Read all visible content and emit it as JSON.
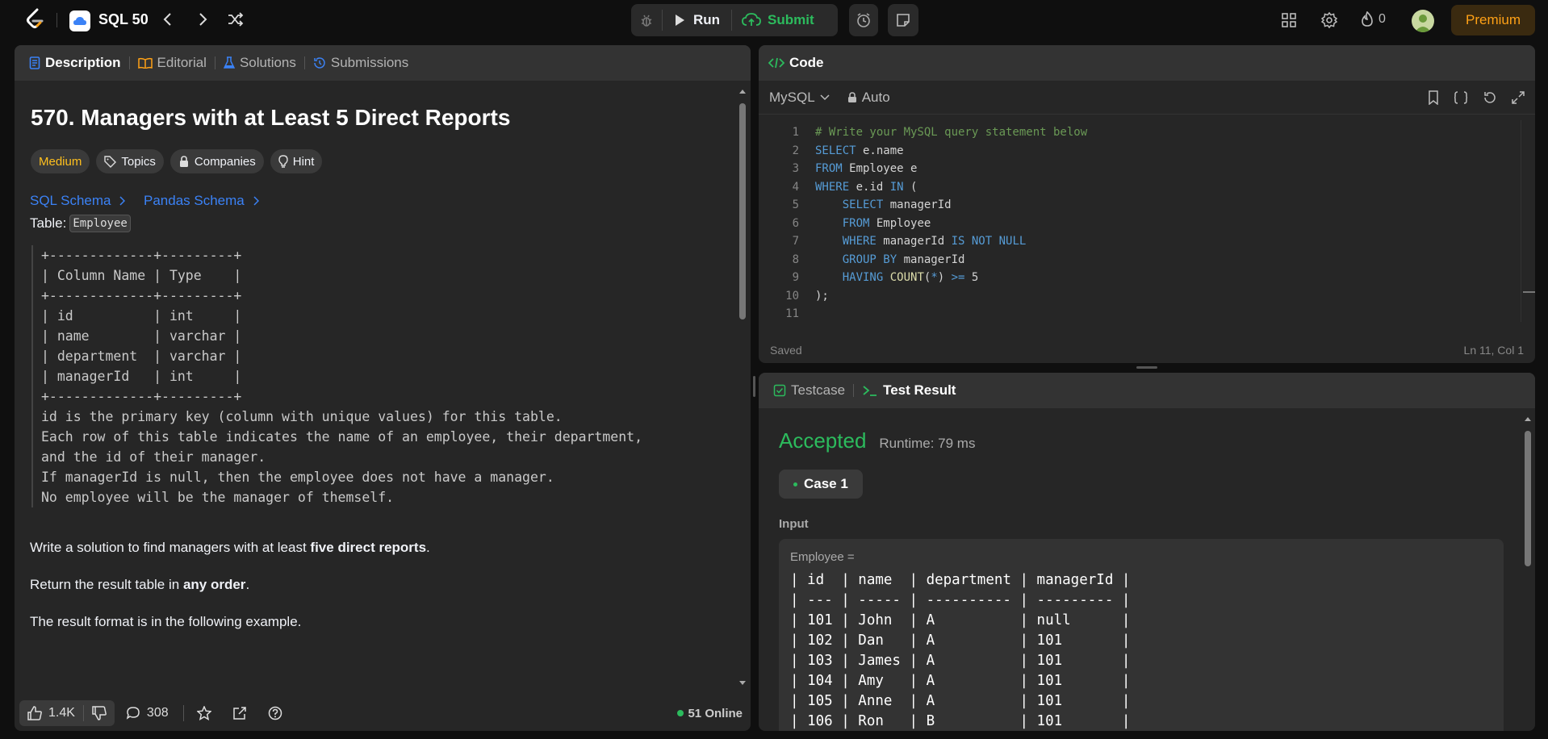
{
  "topbar": {
    "title": "SQL 50",
    "run_label": "Run",
    "submit_label": "Submit",
    "streak_count": "0",
    "premium_label": "Premium"
  },
  "description": {
    "tabs": [
      {
        "label": "Description",
        "icon": "document-icon"
      },
      {
        "label": "Editorial",
        "icon": "book-icon"
      },
      {
        "label": "Solutions",
        "icon": "flask-icon"
      },
      {
        "label": "Submissions",
        "icon": "history-icon"
      }
    ],
    "title": "570. Managers with at Least 5 Direct Reports",
    "difficulty": "Medium",
    "tags": [
      "Topics",
      "Companies",
      "Hint"
    ],
    "schema_links": [
      "SQL Schema",
      "Pandas Schema"
    ],
    "table_prefix": "Table:",
    "table_name": "Employee",
    "schema_block": [
      "+-------------+---------+",
      "| Column Name | Type    |",
      "+-------------+---------+",
      "| id          | int     |",
      "| name        | varchar |",
      "| department  | varchar |",
      "| managerId   | int     |",
      "+-------------+---------+",
      "id is the primary key (column with unique values) for this table.",
      "Each row of this table indicates the name of an employee, their department,",
      "and the id of their manager.",
      "If managerId is null, then the employee does not have a manager.",
      "No employee will be the manager of themself."
    ],
    "para1_pre": "Write a solution to find managers with at least ",
    "para1_bold": "five direct reports",
    "para1_post": ".",
    "para2_pre": "Return the result table in ",
    "para2_bold": "any order",
    "para2_post": ".",
    "para3": "The result format is in the following example.",
    "likes": "1.4K",
    "comments": "308",
    "online": "51 Online"
  },
  "code": {
    "header": "Code",
    "language": "MySQL",
    "mode": "Auto",
    "line_numbers": [
      "1",
      "2",
      "3",
      "4",
      "5",
      "6",
      "7",
      "8",
      "9",
      "10",
      "11"
    ],
    "status": "Saved",
    "cursor": "Ln 11, Col 1"
  },
  "result": {
    "tabs": [
      "Testcase",
      "Test Result"
    ],
    "verdict": "Accepted",
    "runtime": "Runtime: 79 ms",
    "case_label": "Case 1",
    "input_label": "Input",
    "var_label": "Employee =",
    "table_rows": [
      "| id  | name  | department | managerId |",
      "| --- | ----- | ---------- | --------- |",
      "| 101 | John  | A          | null      |",
      "| 102 | Dan   | A          | 101       |",
      "| 103 | James | A          | 101       |",
      "| 104 | Amy   | A          | 101       |",
      "| 105 | Anne  | A          | 101       |",
      "| 106 | Ron   | B          | 101       |"
    ]
  },
  "colors": {
    "accent_green": "#2cbb5d",
    "medium_yellow": "#ffc01e",
    "link_blue": "#3b82f6",
    "premium_orange": "#ffa116"
  }
}
